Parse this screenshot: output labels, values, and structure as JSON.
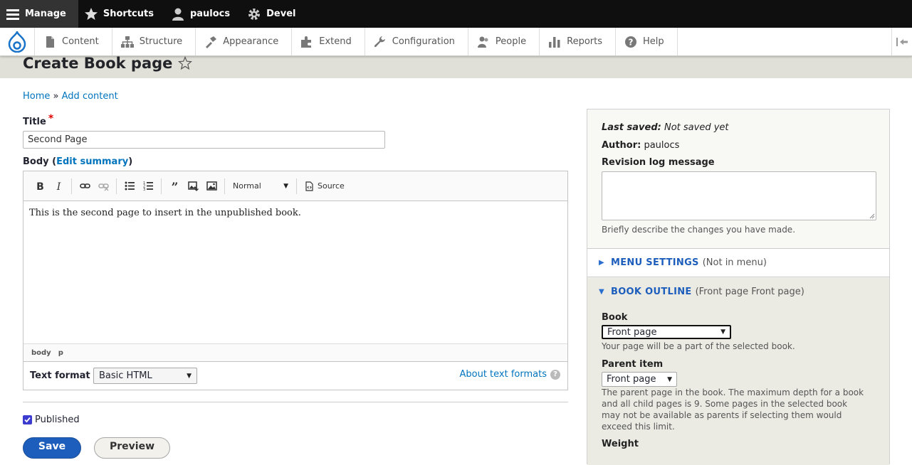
{
  "toolbar": {
    "manage": "Manage",
    "shortcuts": "Shortcuts",
    "user": "paulocs",
    "devel": "Devel"
  },
  "admin_menu": {
    "items": [
      {
        "label": "Content",
        "icon": "content-icon"
      },
      {
        "label": "Structure",
        "icon": "structure-icon"
      },
      {
        "label": "Appearance",
        "icon": "appearance-icon"
      },
      {
        "label": "Extend",
        "icon": "extend-icon"
      },
      {
        "label": "Configuration",
        "icon": "configuration-icon"
      },
      {
        "label": "People",
        "icon": "people-icon"
      },
      {
        "label": "Reports",
        "icon": "reports-icon"
      },
      {
        "label": "Help",
        "icon": "help-icon"
      }
    ]
  },
  "page": {
    "title": "Create Book page"
  },
  "breadcrumb": {
    "home": "Home",
    "separator": "»",
    "add_content": "Add content"
  },
  "form": {
    "title_label": "Title",
    "required_mark": "*",
    "title_value": "Second Page",
    "body_label": "Body",
    "edit_summary": "Edit summary",
    "editor": {
      "heading_dropdown": "Normal",
      "source_label": "Source",
      "content": "This is the second page to insert in the unpublished book.",
      "path": [
        "body",
        "p"
      ]
    },
    "text_format_label": "Text format",
    "text_format_value": "Basic HTML",
    "about_formats": "About text formats",
    "published_label": "Published",
    "published_checked": true,
    "save_label": "Save",
    "preview_label": "Preview"
  },
  "sidebar": {
    "last_saved_label": "Last saved:",
    "last_saved_value": "Not saved yet",
    "author_label": "Author:",
    "author_value": "paulocs",
    "revision_label": "Revision log message",
    "revision_help": "Briefly describe the changes you have made.",
    "menu_settings": "MENU SETTINGS",
    "menu_settings_summary": "(Not in menu)",
    "book_outline": "BOOK OUTLINE",
    "book_outline_summary": "(Front page Front page)",
    "book_label": "Book",
    "book_value": "Front page",
    "book_help": "Your page will be a part of the selected book.",
    "parent_label": "Parent item",
    "parent_value": "Front page",
    "parent_help_lines": [
      "The parent page in the book. The maximum depth for a book",
      "and all child pages is 9. Some pages in the selected book",
      "may not be available as parents if selecting them would",
      "exceed this limit."
    ],
    "weight_label": "Weight"
  },
  "colors": {
    "link": "#0074bd",
    "primary_button": "#1d5ebc",
    "toolbar_bg": "#0f0f0f",
    "required": "#e00000"
  }
}
